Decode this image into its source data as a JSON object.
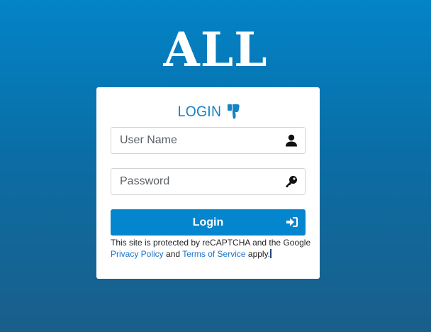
{
  "brand": {
    "logo_text": "ALL"
  },
  "login_card": {
    "title": "LOGIN",
    "title_icon": "thumbs-down-icon",
    "username": {
      "placeholder": "User Name",
      "value": "",
      "icon": "user-icon"
    },
    "password": {
      "placeholder": "Password",
      "value": "",
      "icon": "key-icon"
    },
    "submit": {
      "label": "Login",
      "icon": "sign-in-icon"
    },
    "recaptcha": {
      "prefix": "This site is protected by reCAPTCHA and the Google",
      "privacy_link": "Privacy Policy",
      "and": "and",
      "terms_link": "Terms of Service",
      "suffix": "apply."
    }
  },
  "colors": {
    "background_top": "#0384c8",
    "background_bottom": "#1a5e8a",
    "accent": "#0486ce",
    "title": "#1584c4",
    "link": "#1a73c9"
  }
}
